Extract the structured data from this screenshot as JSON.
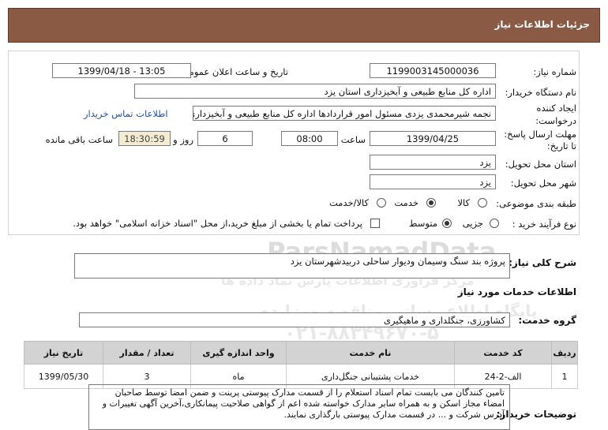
{
  "header": {
    "title": "جزئیات اطلاعات نیاز"
  },
  "need": {
    "number_label": "شماره نیاز:",
    "number": "1199003145000036",
    "announce_label": "تاریخ و ساعت اعلان عمومی:",
    "announce": "1399/04/18 - 13:05",
    "buyer_label": "نام دستگاه خریدار:",
    "buyer": "اداره کل منابع طبیعی و آبخیزداری استان یزد",
    "creator_label_1": "ایجاد کننده",
    "creator_label_2": "درخواست:",
    "creator": "نجمه شیرمحمدی یزدی مسئول امور قراردادها  اداره کل منابع طبیعی و آبخیزداری",
    "contact_link": "اطلاعات تماس خریدار",
    "deadline_label_1": "مهلت ارسال پاسخ:",
    "deadline_label_2": "تا تاریخ:",
    "deadline_date": "1399/04/25",
    "time_label": "ساعت",
    "deadline_time": "08:00",
    "days": "6",
    "days_label": "روز و",
    "remaining": "18:30:59",
    "remaining_label": "ساعت باقی مانده",
    "province_label": "استان محل تحویل:",
    "province": "یزد",
    "city_label": "شهر محل تحویل:",
    "city": "یزد",
    "category_label": "طبقه بندی موضوعی:",
    "category_options": [
      "کالا",
      "خدمت",
      "کالا/خدمت"
    ],
    "process_label": "نوع فرآیند خرید :",
    "process_options": [
      "جزیی",
      "متوسط"
    ],
    "payment_note": "پرداخت تمام یا بخشی از مبلغ خرید،از محل \"اسناد خزانه اسلامی\" خواهد بود."
  },
  "summary": {
    "label": "شرح کلی نیاز:",
    "text": "پروژه بند سنگ وسیمان وديوار ساحلی دربیدشهرستان یزد"
  },
  "services": {
    "section_title": "اطلاعات خدمات مورد نیاز",
    "group_label": "گروه خدمت:",
    "group": "کشاورزی، جنگلداری و ماهیگیری",
    "columns": [
      "ردیف",
      "کد خدمت",
      "نام خدمت",
      "واحد اندازه گیری",
      "تعداد / مقدار",
      "تاریخ نیاز"
    ],
    "rows": [
      [
        "1",
        "الف-2-24",
        "خدمات پشتیبانی جنگل‌داری",
        "ماه",
        "3",
        "1399/05/30"
      ]
    ]
  },
  "buyer_notes": {
    "label": "توضیحات خریدار:",
    "text": "تامین کنندگان می بایست تمام اسناد استعلام را از قسمت مدارک پیوستی پرینت و ضمن امضا توسط صاحبان امضاء مجاز اسکن و به همراه سایر مدارک خواسته شده اعم از گواهی صلاحیت پیمانکاری،آخرین آگهی تغییرات و آدرس شرکت و ... در قسمت مدارک پیوستی بارگذاری نمایند."
  },
  "watermark": {
    "line1": "ParsNamadData",
    "line2": "مرکز فراوری اطلاعات پارس نماد داده ها",
    "line3": "پایگاه اطلاع رسانی مناقصه ومزایده",
    "line4": "۰۲۱-۸۸۳۴۹۶۷۰-۵"
  },
  "colors": {
    "header_bg": "#8a5a44",
    "table_header_bg": "#d3d3d3",
    "remaining_bg": "#f3ecd0",
    "link": "#1f4fb4"
  }
}
